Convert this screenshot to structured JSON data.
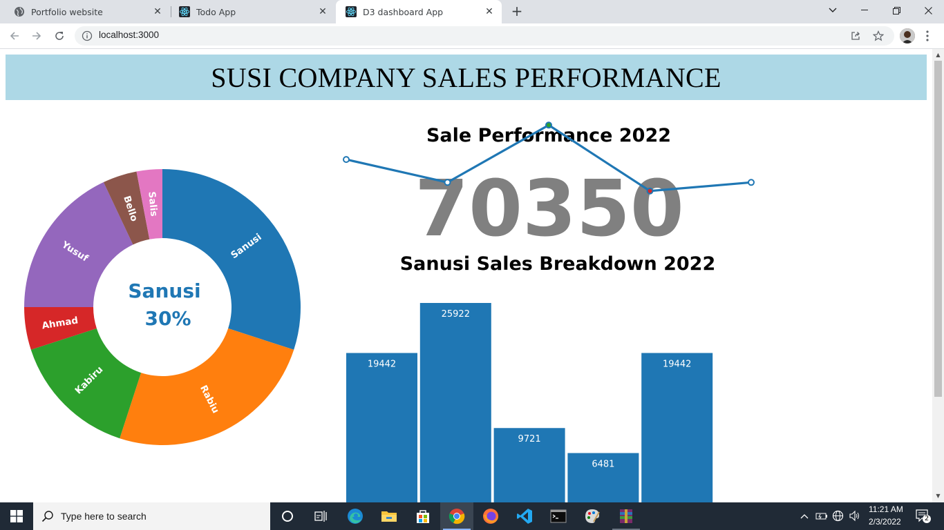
{
  "browser": {
    "tabs": [
      {
        "title": "Portfolio website",
        "icon": "globe-icon",
        "active": false
      },
      {
        "title": "Todo App",
        "icon": "react-icon",
        "active": false
      },
      {
        "title": "D3 dashboard App",
        "icon": "react-icon",
        "active": true
      }
    ],
    "url": "localhost:3000"
  },
  "page": {
    "header_title": "SUSI COMPANY SALES PERFORMANCE",
    "donut": {
      "center_name": "Sanusi",
      "center_percent": "30%",
      "accent_color": "#1f77b4",
      "slices": [
        {
          "label": "Sanusi",
          "value": 30,
          "color": "#1f77b4"
        },
        {
          "label": "Rabiu",
          "value": 25,
          "color": "#ff7f0e"
        },
        {
          "label": "Kabiru",
          "value": 15,
          "color": "#2ca02c"
        },
        {
          "label": "Ahmad",
          "value": 5,
          "color": "#d62728"
        },
        {
          "label": "Yusuf",
          "value": 18,
          "color": "#9467bd"
        },
        {
          "label": "Bello",
          "value": 4,
          "color": "#8c564b"
        },
        {
          "label": "Salis",
          "value": 3,
          "color": "#e377c2"
        }
      ]
    },
    "line": {
      "title": "Sale Performance 2022",
      "total": "70350",
      "values": [
        13,
        9,
        19,
        7.5,
        9
      ],
      "point_colors": [
        "#ffffff",
        "#ffffff",
        "#2ca02c",
        "#d62728",
        "#ffffff"
      ],
      "line_color": "#1f77b4"
    },
    "bar": {
      "title": "Sanusi Sales Breakdown 2022",
      "values": [
        19442,
        25922,
        9721,
        6481,
        19442
      ],
      "color": "#1f77b4"
    }
  },
  "taskbar": {
    "search_placeholder": "Type here to search",
    "time": "11:21 AM",
    "date": "2/3/2022",
    "notification_count": "2"
  }
}
